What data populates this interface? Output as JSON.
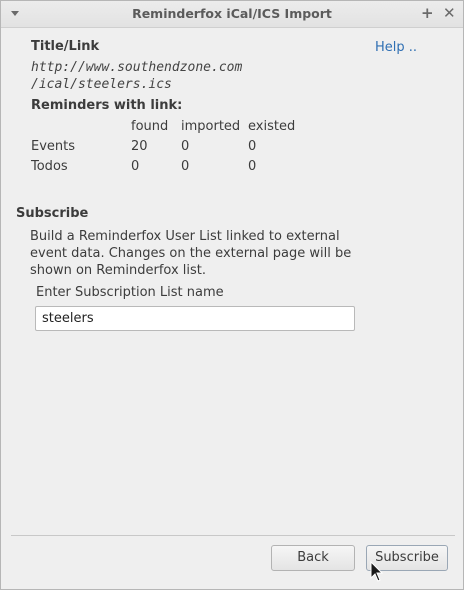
{
  "window": {
    "title": "Reminderfox iCal/ICS Import"
  },
  "header": {
    "title_label": "Title/Link",
    "help_link": "Help ..",
    "url_line1": "http://www.southendzone.com",
    "url_line2": "/ical/steelers.ics"
  },
  "reminders": {
    "heading": "Reminders with link:",
    "columns": [
      "found",
      "imported",
      "existed"
    ],
    "rows": [
      {
        "label": "Events",
        "values": [
          "20",
          "0",
          "0"
        ]
      },
      {
        "label": "Todos",
        "values": [
          "0",
          "0",
          "0"
        ]
      }
    ]
  },
  "subscribe": {
    "heading": "Subscribe",
    "description": "Build a Reminderfox User List linked to external event data. Changes on the external page will be shown on Reminderfox list.",
    "field_label": "Enter Subscription List name",
    "field_value": "steelers"
  },
  "buttons": {
    "back": "Back",
    "subscribe": "Subscribe"
  }
}
